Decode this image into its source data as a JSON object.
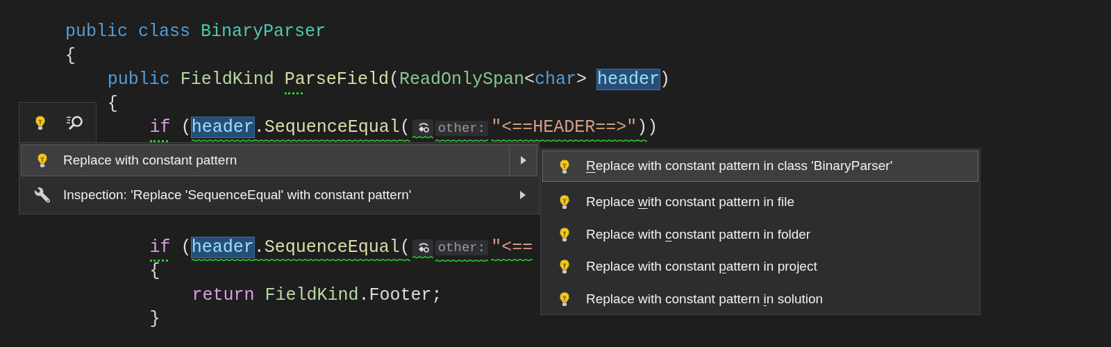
{
  "code_lines": [
    {
      "kind": "code",
      "tokens": [
        {
          "text": "public class ",
          "kind": "keyword"
        },
        {
          "text": "BinaryParser",
          "kind": "class"
        }
      ]
    },
    {
      "kind": "code",
      "tokens": [
        {
          "text": "{",
          "kind": "plain"
        }
      ],
      "children": [
        {
          "kind": "code",
          "tokens": [
            {
              "text": "public ",
              "kind": "keyword"
            },
            {
              "text": "FieldKind ",
              "kind": "enum"
            },
            {
              "text": "ParseField",
              "kind": "method",
              "dots": true
            },
            {
              "text": "(",
              "kind": "plain"
            },
            {
              "text": "ReadOnlySpan",
              "kind": "struct"
            },
            {
              "text": "<",
              "kind": "plain"
            },
            {
              "text": "char",
              "kind": "keyword"
            },
            {
              "text": "> ",
              "kind": "plain"
            },
            {
              "text": "header",
              "kind": "highlight"
            },
            {
              "text": ")",
              "kind": "plain"
            }
          ]
        },
        {
          "kind": "code",
          "tokens": [
            {
              "text": "{",
              "kind": "plain"
            }
          ],
          "children": [
            {
              "kind": "code",
              "tokens": [
                {
                  "text": "if",
                  "kind": "control",
                  "dots": true
                },
                {
                  "text": " (",
                  "kind": "plain"
                },
                {
                  "text": "header",
                  "kind": "highlight",
                  "squiggle": true
                },
                {
                  "text": ".",
                  "kind": "plain",
                  "squiggle": true
                },
                {
                  "text": "SequenceEqual",
                  "kind": "method",
                  "squiggle": true
                },
                {
                  "text": "(",
                  "kind": "plain",
                  "squiggle": true
                },
                {
                  "kind": "hint-icon",
                  "squiggle": true
                },
                {
                  "text": "other:",
                  "kind": "hint",
                  "squiggle": true
                },
                {
                  "text": "\"<==HEADER==>\"",
                  "kind": "string",
                  "squiggle": true
                },
                {
                  "text": ")",
                  "kind": "plain",
                  "squiggle": true
                },
                {
                  "text": ")",
                  "kind": "plain"
                }
              ]
            },
            {
              "kind": "hidden"
            },
            {
              "kind": "hidden"
            },
            {
              "kind": "hidden"
            },
            {
              "kind": "hidden"
            },
            {
              "kind": "code",
              "tokens": [
                {
                  "text": "if",
                  "kind": "control",
                  "dots": true
                },
                {
                  "text": " (",
                  "kind": "plain"
                },
                {
                  "text": "header",
                  "kind": "highlight",
                  "squiggle": true
                },
                {
                  "text": ".",
                  "kind": "plain",
                  "squiggle": true
                },
                {
                  "text": "SequenceEqual",
                  "kind": "method",
                  "squiggle": true
                },
                {
                  "text": "(",
                  "kind": "plain",
                  "squiggle": true
                },
                {
                  "kind": "hint-icon",
                  "squiggle": true
                },
                {
                  "text": "other:",
                  "kind": "hint",
                  "squiggle": true
                },
                {
                  "text": "\"<==",
                  "kind": "string",
                  "squiggle": true
                }
              ]
            },
            {
              "kind": "code",
              "tokens": [
                {
                  "text": "{",
                  "kind": "plain"
                }
              ],
              "children": [
                {
                  "kind": "code",
                  "tokens": [
                    {
                      "text": "return ",
                      "kind": "control"
                    },
                    {
                      "text": "FieldKind",
                      "kind": "enum"
                    },
                    {
                      "text": ".",
                      "kind": "plain"
                    },
                    {
                      "text": "Footer",
                      "kind": "plain"
                    },
                    {
                      "text": ";",
                      "kind": "plain"
                    }
                  ]
                }
              ]
            },
            {
              "kind": "code",
              "tokens": [
                {
                  "text": "}",
                  "kind": "plain"
                }
              ]
            }
          ]
        }
      ]
    }
  ],
  "menu": {
    "items": [
      {
        "kind": "fix",
        "label": "Replace with constant pattern",
        "selected": true,
        "submenu": true
      },
      {
        "kind": "inspection",
        "label": "Inspection: 'Replace 'SequenceEqual' with constant pattern'",
        "selected": false,
        "submenu": true
      }
    ]
  },
  "submenu": {
    "items": [
      {
        "key": "R",
        "after": "eplace with constant pattern in class 'BinaryParser'",
        "selected": true
      },
      {
        "before": "Replace ",
        "key": "w",
        "after": "ith constant pattern in file",
        "selected": false
      },
      {
        "before": "Replace with ",
        "key": "c",
        "after": "onstant pattern in folder",
        "selected": false
      },
      {
        "before": "Replace with constant ",
        "key": "p",
        "after": "attern in project",
        "selected": false
      },
      {
        "before": "Replace with constant pattern ",
        "key": "i",
        "after": "n solution",
        "selected": false
      }
    ]
  }
}
